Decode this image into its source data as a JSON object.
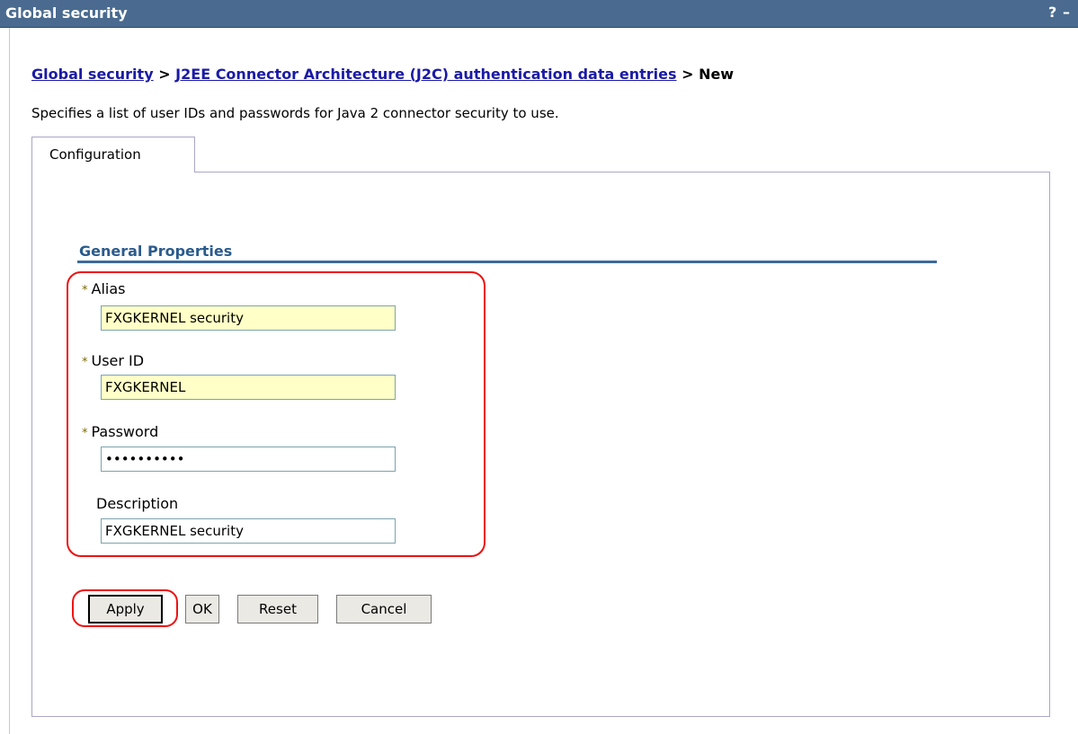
{
  "window": {
    "title": "Global security",
    "help_label": "?",
    "minimize_label": "–"
  },
  "breadcrumb": {
    "link1": "Global security",
    "sep1": " > ",
    "link2": "J2EE Connector Architecture (J2C) authentication data entries",
    "sep2": " > ",
    "current": "New"
  },
  "description": "Specifies a list of user IDs and passwords for Java 2 connector security to use.",
  "tabs": [
    {
      "label": "Configuration"
    }
  ],
  "section": {
    "title": "General Properties"
  },
  "fields": {
    "required_marker": "*",
    "alias": {
      "label": "Alias",
      "value": "FXGKERNEL security"
    },
    "user_id": {
      "label": "User ID",
      "value": "FXGKERNEL"
    },
    "password": {
      "label": "Password",
      "value": "••••••••••"
    },
    "description": {
      "label": "Description",
      "value": "FXGKERNEL security"
    }
  },
  "buttons": {
    "apply": "Apply",
    "ok": "OK",
    "reset": "Reset",
    "cancel": "Cancel"
  },
  "colors": {
    "titlebar": "#4a6b8f",
    "link": "#1a1aa6",
    "section": "#2a5b8c",
    "required_field_bg": "#ffffc7",
    "highlight": "#ee1111"
  }
}
